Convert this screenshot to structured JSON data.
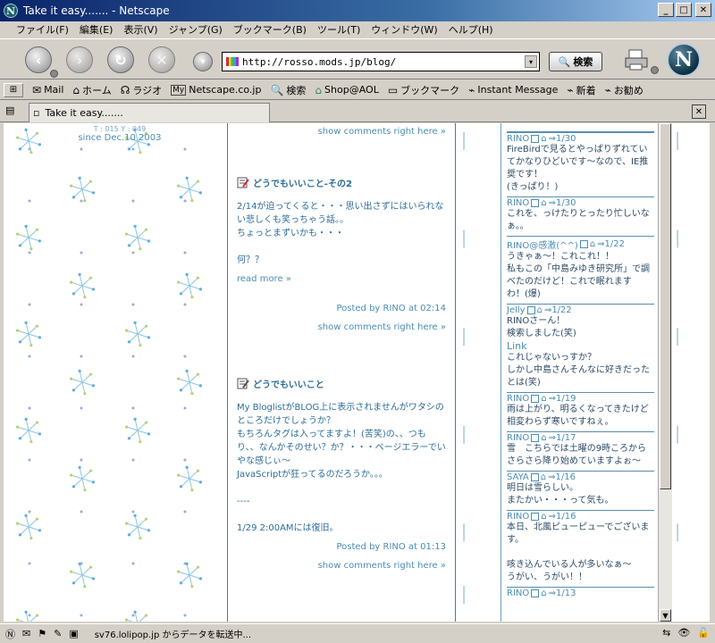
{
  "window": {
    "title": "Take it easy....... - Netscape"
  },
  "menu": [
    "ファイル(F)",
    "編集(E)",
    "表示(V)",
    "ジャンプ(G)",
    "ブックマーク(B)",
    "ツール(T)",
    "ウィンドウ(W)",
    "ヘルプ(H)"
  ],
  "nav": {
    "url": "http://rosso.mods.jp/blog/",
    "search_label": "検索"
  },
  "personal_toolbar": [
    "Mail",
    "ホーム",
    "ラジオ",
    "Netscape.co.jp",
    "検索",
    "Shop@AOL",
    "ブックマーク",
    "Instant Message",
    "新着",
    "お勧め"
  ],
  "tab": {
    "title": "Take it easy......."
  },
  "sidebar": {
    "counter": "T : 015  Y : 049",
    "since": "since Dec.10 2003"
  },
  "main": {
    "top_show_comments": "show comments right here »",
    "posts": [
      {
        "title": "どうでもいいこと-その2",
        "body": "2/14が迫ってくると・・・思い出さずにはいられない悲しくも笑っちゃう話。。\nちょっとまずいかも・・・\n\n何？？",
        "read_more": "read more »",
        "posted": "Posted by RINO at 02:14",
        "show_comments": "show comments right here »"
      },
      {
        "title": "どうでもいいこと",
        "body": "My BloglistがBLOG上に表示されませんがワタシのところだけでしょうか？\nもちろんタグは入ってますよ！(苦笑)の、、つもり、、なんかそのせい？か？・・・ページエラーでいやな感じぃ～\nJavaScriptが狂ってるのだろうか。。。\n\n----\n\n1/29  2:00AMには復旧。",
        "posted": "Posted by RINO at 01:13",
        "show_comments": "show comments right here »"
      }
    ]
  },
  "comments": [
    {
      "author": "RINO",
      "date": "⇒1/30",
      "body": "FireBirdで見るとやっぱりずれていてかなりひどいです～なので、IE推奨です！\n(きっぱり！)"
    },
    {
      "author": "RINO",
      "date": "⇒1/30",
      "body": "これを、っけたりとったり忙しいなぁ。。"
    },
    {
      "author": "RINO@感激(^^)",
      "date": "⇒1/22",
      "body": "うきゃぁ～！これこれ！！\n私もこの「中島みゆき研究所」で調べたのだけど！これで眠れます\nわ！(爆)"
    },
    {
      "author": "Jelly",
      "date": "⇒1/22",
      "body": "RINOさーん！\n検索しました(笑)",
      "link": "Link",
      "body2": "これじゃないっすか？\nしかし中島さんそんなに好きだったとは(笑)"
    },
    {
      "author": "RINO",
      "date": "⇒1/19",
      "body": "雨は上がり、明るくなってきたけど相変わらず寒いですねぇ。"
    },
    {
      "author": "RINO",
      "date": "⇒1/17",
      "body": "雪　こちらでは土曜の9時ころからさらさら降り始めていますよぉ～"
    },
    {
      "author": "SAYA",
      "date": "⇒1/16",
      "body": "明日は雪らしい。\nまたかい・・・って気も。"
    },
    {
      "author": "RINO",
      "date": "⇒1/16",
      "body": "本日、北風ピューピューでございます。\n\n咳き込んでいる人が多いなぁ～\nうがい、うがい！！"
    },
    {
      "author": "RINO",
      "date": "⇒1/13",
      "body": ""
    }
  ],
  "status": {
    "text": "sv76.lolipop.jp からデータを転送中..."
  }
}
